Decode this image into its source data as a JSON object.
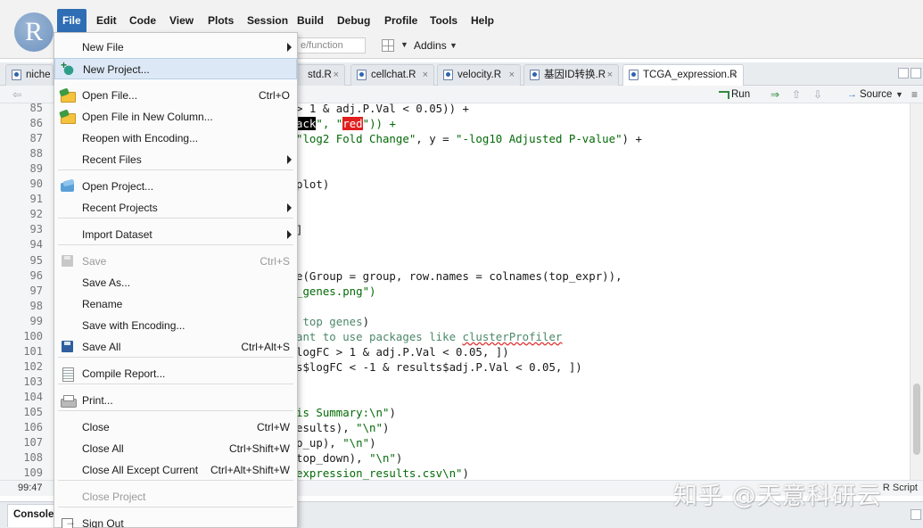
{
  "menubar": {
    "logo_letter": "R",
    "items": [
      "File",
      "Edit",
      "Code",
      "View",
      "Plots",
      "Session",
      "Build",
      "Debug",
      "Profile",
      "Tools",
      "Help"
    ]
  },
  "toolbar": {
    "goto_placeholder": "e/function",
    "addins_label": "Addins"
  },
  "tabs": [
    {
      "label": "niche"
    },
    {
      "label": "std.R"
    },
    {
      "label": "cellchat.R"
    },
    {
      "label": "velocity.R"
    },
    {
      "label": "基因ID转换.R"
    },
    {
      "label": "TCGA_expression.R"
    }
  ],
  "editor_toolbar": {
    "run_label": "Run",
    "source_label": "Source"
  },
  "file_menu": {
    "items": [
      {
        "label": "New File",
        "shortcut": "",
        "submenu": true,
        "icon": "none",
        "disabled": false
      },
      {
        "label": "New Project...",
        "shortcut": "",
        "submenu": false,
        "icon": "new-project-icon",
        "disabled": false,
        "hover": true
      },
      {
        "label": "Open File...",
        "shortcut": "Ctrl+O",
        "submenu": false,
        "icon": "open-folder-icon",
        "disabled": false
      },
      {
        "label": "Open File in New Column...",
        "shortcut": "",
        "submenu": false,
        "icon": "open-folder-icon",
        "disabled": false
      },
      {
        "label": "Reopen with Encoding...",
        "shortcut": "",
        "submenu": false,
        "icon": "none",
        "disabled": false
      },
      {
        "label": "Recent Files",
        "shortcut": "",
        "submenu": true,
        "icon": "none",
        "disabled": false
      },
      {
        "label": "Open Project...",
        "shortcut": "",
        "submenu": false,
        "icon": "open-project-icon",
        "disabled": false
      },
      {
        "label": "Recent Projects",
        "shortcut": "",
        "submenu": true,
        "icon": "none",
        "disabled": false
      },
      {
        "label": "Import Dataset",
        "shortcut": "",
        "submenu": true,
        "icon": "none",
        "disabled": false
      },
      {
        "label": "Save",
        "shortcut": "Ctrl+S",
        "submenu": false,
        "icon": "save-icon",
        "disabled": true
      },
      {
        "label": "Save As...",
        "shortcut": "",
        "submenu": false,
        "icon": "none",
        "disabled": false
      },
      {
        "label": "Rename",
        "shortcut": "",
        "submenu": false,
        "icon": "none",
        "disabled": false
      },
      {
        "label": "Save with Encoding...",
        "shortcut": "",
        "submenu": false,
        "icon": "none",
        "disabled": false
      },
      {
        "label": "Save All",
        "shortcut": "Ctrl+Alt+S",
        "submenu": false,
        "icon": "save-all-icon",
        "disabled": false
      },
      {
        "label": "Compile Report...",
        "shortcut": "",
        "submenu": false,
        "icon": "compile-report-icon",
        "disabled": false
      },
      {
        "label": "Print...",
        "shortcut": "",
        "submenu": false,
        "icon": "print-icon",
        "disabled": false
      },
      {
        "label": "Close",
        "shortcut": "Ctrl+W",
        "submenu": false,
        "icon": "none",
        "disabled": false
      },
      {
        "label": "Close All",
        "shortcut": "Ctrl+Shift+W",
        "submenu": false,
        "icon": "none",
        "disabled": false
      },
      {
        "label": "Close All Except Current",
        "shortcut": "Ctrl+Alt+Shift+W",
        "submenu": false,
        "icon": "none",
        "disabled": false
      },
      {
        "label": "Close Project",
        "shortcut": "",
        "submenu": false,
        "icon": "none",
        "disabled": true
      },
      {
        "label": "Sign Out",
        "shortcut": "",
        "submenu": false,
        "icon": "sign-out-icon",
        "disabled": false
      }
    ]
  },
  "editor": {
    "line_numbers": [
      "85",
      "86",
      "87",
      "88",
      "89",
      "90",
      "91",
      "92",
      "93",
      "94",
      "95",
      "96",
      "97",
      "98",
      "99",
      "100",
      "101",
      "102",
      "103",
      "104",
      "105",
      "106",
      "107",
      "108",
      "109"
    ],
    "lines": [
      {
        "segments": [
          {
            "t": "> 1 & adj.P.Val < 0.05)) +",
            "c": ""
          }
        ]
      },
      {
        "segments": [
          {
            "t": "ack",
            "c": "hl-black"
          },
          {
            "t": "\", \"",
            "c": "str"
          },
          {
            "t": "red",
            "c": "hl-red"
          },
          {
            "t": "\")) +",
            "c": "str"
          }
        ]
      },
      {
        "segments": [
          {
            "t": "\"log2 Fold Change\"",
            "c": "str"
          },
          {
            "t": ", y = ",
            "c": ""
          },
          {
            "t": "\"-log10 Adjusted P-value\"",
            "c": "str"
          },
          {
            "t": ") +",
            "c": ""
          }
        ]
      },
      {
        "segments": []
      },
      {
        "segments": []
      },
      {
        "segments": [
          {
            "t": "plot)",
            "c": ""
          }
        ]
      },
      {
        "segments": []
      },
      {
        "segments": []
      },
      {
        "segments": [
          {
            "t": "]",
            "c": ""
          }
        ]
      },
      {
        "segments": []
      },
      {
        "segments": []
      },
      {
        "segments": [
          {
            "t": "e(Group = group, row.names = colnames(top_expr)),",
            "c": ""
          }
        ]
      },
      {
        "segments": [
          {
            "t": "_genes.png\")",
            "c": "str"
          }
        ]
      },
      {
        "segments": []
      },
      {
        "segments": [
          {
            "t": " top genes",
            "c": "cmt"
          },
          {
            "t": ")",
            "c": ""
          }
        ]
      },
      {
        "segments": [
          {
            "t": "ant to use packages like ",
            "c": "cmt"
          },
          {
            "t": "clusterProfiler",
            "c": "cmt und"
          }
        ]
      },
      {
        "segments": [
          {
            "t": "logFC > 1 & adj.P.Val < 0.05, ])",
            "c": ""
          }
        ]
      },
      {
        "segments": [
          {
            "t": "s$logFC < -1 & results$adj.P.Val < 0.05, ])",
            "c": ""
          }
        ]
      },
      {
        "segments": []
      },
      {
        "segments": []
      },
      {
        "segments": [
          {
            "t": "is Summary:\\n\"",
            "c": "str"
          },
          {
            "t": ")",
            "c": ""
          }
        ]
      },
      {
        "segments": [
          {
            "t": "esults), ",
            "c": ""
          },
          {
            "t": "\"\\n\"",
            "c": "str"
          },
          {
            "t": ")",
            "c": ""
          }
        ]
      },
      {
        "segments": [
          {
            "t": "p_up), ",
            "c": ""
          },
          {
            "t": "\"\\n\"",
            "c": "str"
          },
          {
            "t": ")",
            "c": ""
          }
        ]
      },
      {
        "segments": [
          {
            "t": "top_down), ",
            "c": ""
          },
          {
            "t": "\"\\n\"",
            "c": "str"
          },
          {
            "t": ")",
            "c": ""
          }
        ]
      },
      {
        "segments": [
          {
            "t": "expression_results.csv\\n\"",
            "c": "str"
          },
          {
            "t": ")",
            "c": ""
          }
        ]
      }
    ]
  },
  "status": {
    "cursor": "99:47",
    "file_type": "R Script"
  },
  "console": {
    "tab_label": "Console"
  },
  "watermark": "知乎 @天意科研云"
}
